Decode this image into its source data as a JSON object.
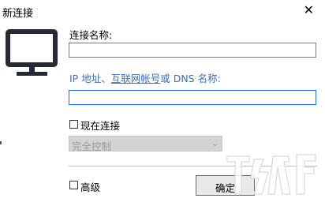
{
  "window": {
    "title": "新连接",
    "close_glyph": "✕"
  },
  "form": {
    "name_label": "连接名称:",
    "name_value": "",
    "ip_label_prefix": "IP 地址、",
    "ip_label_link": "互联网帐号",
    "ip_label_suffix": "或 DNS 名称:",
    "ip_value": "",
    "connect_now_label": "现在连接",
    "connect_now_checked": false,
    "control_mode_value": "完全控制",
    "advanced_label": "高级",
    "advanced_checked": false,
    "ok_button_label": "确定"
  },
  "icons": [
    "monitor-icon",
    "close-icon",
    "chevron-down-icon"
  ],
  "colors": {
    "accent_text": "#3a6fc0",
    "focus_border": "#1a73c8",
    "disabled_select": "#d3d3d3"
  }
}
